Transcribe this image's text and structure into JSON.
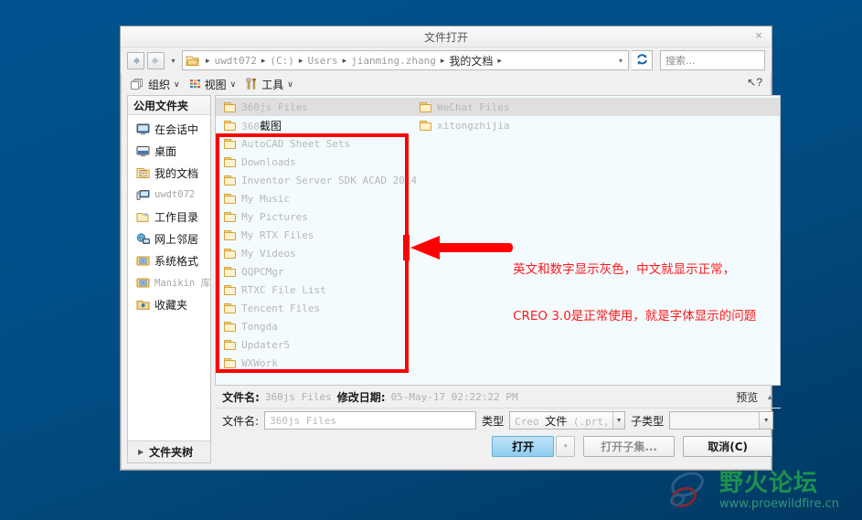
{
  "window": {
    "title": "文件打开",
    "close_label": "×"
  },
  "address_bar": {
    "back_icon": "back-arrow-icon",
    "forward_icon": "forward-arrow-icon",
    "history_caret": "▾",
    "folder_icon": "folder-open-icon",
    "crumbs": [
      "uwdt072",
      "(C:)",
      "Users",
      "jianming.zhang",
      "我的文档"
    ],
    "separator": "▸",
    "dropdown_caret": "▾",
    "refresh_icon": "refresh-icon",
    "search_placeholder": "搜索..."
  },
  "toolbar": {
    "items": [
      {
        "label": "组织",
        "caret": "∨",
        "icon": "organize-icon"
      },
      {
        "label": "视图",
        "caret": "∨",
        "icon": "view-grid-icon"
      },
      {
        "label": "工具",
        "caret": "∨",
        "icon": "tools-icon"
      }
    ],
    "help_cursor": "↖?"
  },
  "sidebar": {
    "header": "公用文件夹",
    "items": [
      {
        "label": "在会话中",
        "icon": "monitor-icon",
        "gray": false
      },
      {
        "label": "桌面",
        "icon": "desktop-icon",
        "gray": false
      },
      {
        "label": "我的文档",
        "icon": "documents-icon",
        "gray": false
      },
      {
        "label": "uwdt072",
        "icon": "computer-icon",
        "gray": true
      },
      {
        "label": "工作目录",
        "icon": "working-dir-icon",
        "gray": false
      },
      {
        "label": "网上邻居",
        "icon": "network-icon",
        "gray": false
      },
      {
        "label": "系统格式",
        "icon": "system-format-icon",
        "gray": false
      },
      {
        "label": "Manikin 库",
        "icon": "manikin-lib-icon",
        "gray": false
      },
      {
        "label": "收藏夹",
        "icon": "favorites-icon",
        "gray": false
      }
    ],
    "footer": {
      "label": "文件夹树",
      "triangle": "▶"
    }
  },
  "file_list": {
    "items": [
      {
        "name": "360js Files",
        "selected": true
      },
      {
        "name": "360截图",
        "selected": false
      },
      {
        "name": "AutoCAD Sheet Sets",
        "selected": false
      },
      {
        "name": "Downloads",
        "selected": false
      },
      {
        "name": "Inventor Server SDK ACAD 2014",
        "selected": false
      },
      {
        "name": "My Music",
        "selected": false
      },
      {
        "name": "My Pictures",
        "selected": false
      },
      {
        "name": "My RTX Files",
        "selected": false
      },
      {
        "name": "My Videos",
        "selected": false
      },
      {
        "name": "QQPCMgr",
        "selected": false
      },
      {
        "name": "RTXC File List",
        "selected": false
      },
      {
        "name": "Tencent Files",
        "selected": false
      },
      {
        "name": "Tongda",
        "selected": false
      },
      {
        "name": "Updater5",
        "selected": false
      },
      {
        "name": "WXWork",
        "selected": false
      },
      {
        "name": "WeChat Files",
        "selected": false
      },
      {
        "name": "xitongzhijia",
        "selected": false
      }
    ]
  },
  "annotation": {
    "line1": "英文和数字显示灰色，中文就显示正常，",
    "line2": "CREO 3.0是正常使用，就是字体显示的问题",
    "color": "#ff1a1a"
  },
  "info_row": {
    "filename_key": "文件名:",
    "filename_value": "360js Files",
    "moddate_key": "修改日期:",
    "moddate_value": "05-May-17 02:22:22 PM",
    "preview_label": "预览",
    "preview_triangle": "▲"
  },
  "filename_row": {
    "label": "文件名:",
    "value": "360js Files",
    "type_label": "类型",
    "type_value_en": "Creo",
    "type_value_cn": "文件",
    "type_value_ext": "(.prt, .a",
    "subtype_label": "子类型",
    "subtype_value": ""
  },
  "buttons": {
    "open": "打开",
    "open_caret": "▾",
    "open_subset": "打开子集...",
    "cancel": "取消(C)"
  },
  "watermark": {
    "title": "野火论坛",
    "url": "www.proewildfire.cn",
    "logo_icon": "wildfire-logo-icon"
  }
}
